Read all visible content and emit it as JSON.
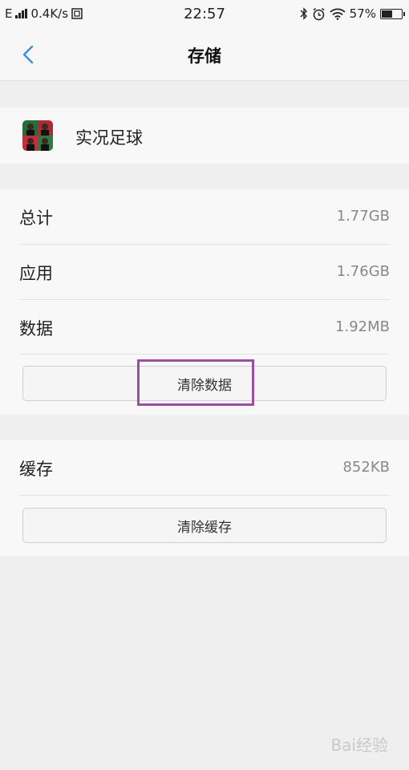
{
  "status_bar": {
    "network": "E",
    "speed": "0.4K/s",
    "time": "22:57",
    "battery": "57%",
    "battery_level": 0.57,
    "icons": [
      "signal-icon",
      "notification-icon",
      "bluetooth-icon",
      "alarm-icon",
      "wifi-icon",
      "battery-icon"
    ]
  },
  "header": {
    "title": "存储",
    "back_icon": "chevron-left-icon",
    "accent": "#3a8ee6"
  },
  "app": {
    "name": "实况足球"
  },
  "storage": {
    "rows": [
      {
        "label": "总计",
        "value": "1.77GB"
      },
      {
        "label": "应用",
        "value": "1.76GB"
      },
      {
        "label": "数据",
        "value": "1.92MB"
      }
    ],
    "clear_data_label": "清除数据"
  },
  "cache": {
    "label": "缓存",
    "value": "852KB",
    "clear_cache_label": "清除缓存"
  },
  "highlight_color": "#9b4fa0",
  "watermark": "Bai经验"
}
